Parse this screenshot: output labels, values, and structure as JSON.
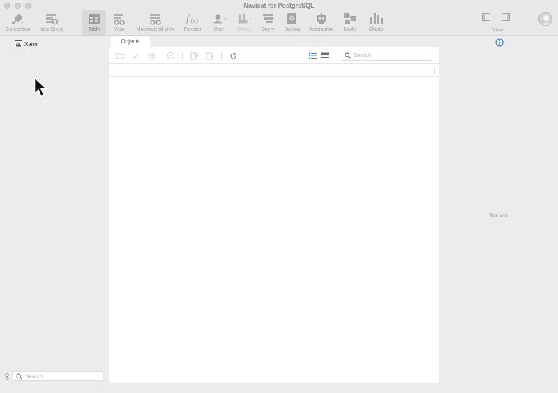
{
  "window": {
    "title": "Navicat for PostgreSQL"
  },
  "toolbar": {
    "items": [
      {
        "label": "Connection",
        "icon": "connection-icon"
      },
      {
        "label": "New Query",
        "icon": "new-query-icon"
      },
      {
        "label": "Table",
        "icon": "table-icon",
        "active": true
      },
      {
        "label": "View",
        "icon": "view-icon"
      },
      {
        "label": "Materialized View",
        "icon": "materialized-view-icon"
      },
      {
        "label": "Function",
        "icon": "function-icon"
      },
      {
        "label": "User",
        "icon": "user-icon"
      },
      {
        "label": "Others",
        "icon": "others-icon",
        "disabled": true
      },
      {
        "label": "Query",
        "icon": "query-icon"
      },
      {
        "label": "Backup",
        "icon": "backup-icon"
      },
      {
        "label": "Automation",
        "icon": "automation-icon"
      },
      {
        "label": "Model",
        "icon": "model-icon"
      },
      {
        "label": "Charts",
        "icon": "charts-icon"
      }
    ],
    "view_label": "View"
  },
  "sidebar": {
    "connection": {
      "label": "Xano",
      "icon": "database-connection-icon"
    },
    "search_placeholder": "Search"
  },
  "main": {
    "tabs": [
      {
        "label": "Objects"
      }
    ],
    "search_placeholder": "Search"
  },
  "info_panel": {
    "empty_text": "No Info"
  },
  "colors": {
    "accent": "#2f7ad6",
    "background": "#ececec",
    "content": "#ffffff"
  }
}
